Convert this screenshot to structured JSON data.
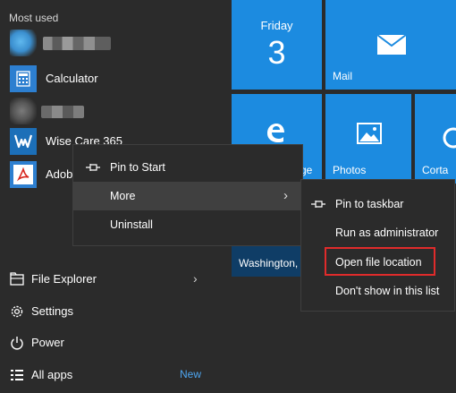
{
  "left_pane": {
    "most_used_heading": "Most used",
    "apps": [
      {
        "label": "",
        "icon": "blurred-app-icon"
      },
      {
        "label": "Calculator",
        "icon": "calculator-icon"
      },
      {
        "label": "",
        "icon": "blurred-app-icon"
      },
      {
        "label": "Wise Care 365",
        "icon": "wise-care-icon"
      },
      {
        "label": "Adobe",
        "icon": "adobe-acrobat-icon"
      }
    ],
    "bottom": [
      {
        "label": "File Explorer",
        "icon": "file-explorer-icon"
      },
      {
        "label": "Settings",
        "icon": "gear-icon"
      },
      {
        "label": "Power",
        "icon": "power-icon"
      },
      {
        "label": "All apps",
        "icon": "list-icon",
        "badge": "New"
      }
    ]
  },
  "tiles": {
    "calendar_day": "Friday",
    "calendar_date": "3",
    "mail": "Mail",
    "edge_partial": "ge",
    "photos": "Photos",
    "cortana_partial": "Corta",
    "weather_partial": "Washington,"
  },
  "context_menu": {
    "items": [
      "Pin to Start",
      "More",
      "Uninstall"
    ]
  },
  "submenu": {
    "items": [
      "Pin to taskbar",
      "Run as administrator",
      "Open file location",
      "Don't show in this list"
    ]
  },
  "colors": {
    "tile_blue": "#1c8be0",
    "highlight_red": "#e02b2b",
    "accent_link": "#4ea6f0"
  }
}
